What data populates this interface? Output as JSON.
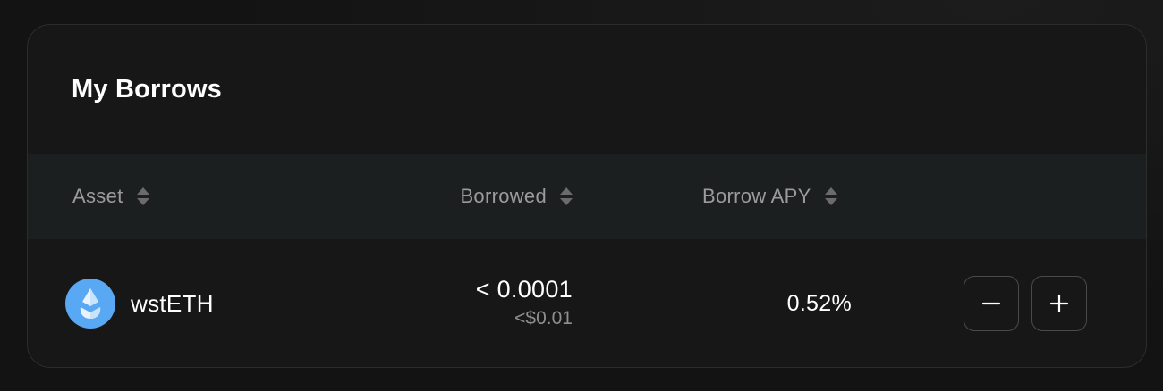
{
  "card": {
    "title": "My Borrows"
  },
  "table": {
    "columns": [
      {
        "label": "Asset",
        "icon": "sort-icon"
      },
      {
        "label": "Borrowed",
        "icon": "sort-icon"
      },
      {
        "label": "Borrow APY",
        "icon": "sort-icon"
      }
    ],
    "rows": [
      {
        "asset": "wstETH",
        "asset_icon": "wsteth-token-icon",
        "borrowed_amount": "< 0.0001",
        "borrowed_usd": "<$0.01",
        "borrow_apy": "0.52%",
        "actions": [
          {
            "name": "repay",
            "icon": "minus-icon"
          },
          {
            "name": "borrow-more",
            "icon": "plus-icon"
          }
        ]
      }
    ]
  },
  "colors": {
    "background": "#131313",
    "card": "#171717",
    "header_row": "#1c1f1f",
    "muted_text": "#9b9b9b",
    "token_blue": "#58a8f4"
  }
}
